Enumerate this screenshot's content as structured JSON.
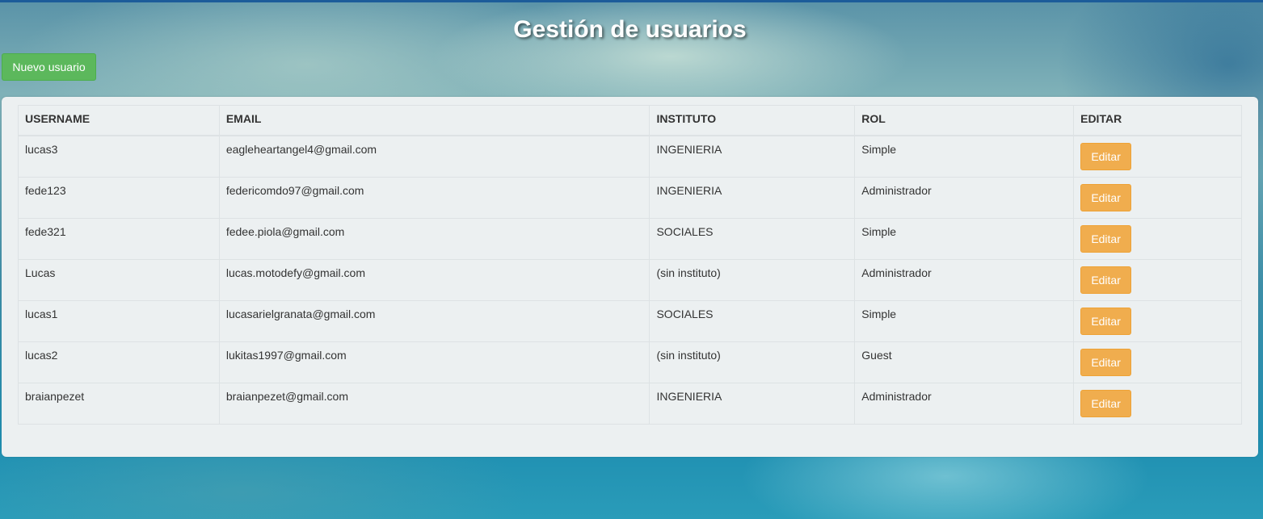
{
  "header": {
    "title": "Gestión de usuarios"
  },
  "toolbar": {
    "new_user_label": "Nuevo usuario"
  },
  "table": {
    "columns": [
      "USERNAME",
      "EMAIL",
      "INSTITUTO",
      "ROL",
      "EDITAR"
    ],
    "rows": [
      {
        "username": "lucas3",
        "email": "eagleheartangel4@gmail.com",
        "instituto": "INGENIERIA",
        "rol": "Simple",
        "edit_label": "Editar"
      },
      {
        "username": "fede123",
        "email": "federicomdo97@gmail.com",
        "instituto": "INGENIERIA",
        "rol": "Administrador",
        "edit_label": "Editar"
      },
      {
        "username": "fede321",
        "email": "fedee.piola@gmail.com",
        "instituto": "SOCIALES",
        "rol": "Simple",
        "edit_label": "Editar"
      },
      {
        "username": "Lucas",
        "email": "lucas.motodefy@gmail.com",
        "instituto": "(sin instituto)",
        "rol": "Administrador",
        "edit_label": "Editar"
      },
      {
        "username": "lucas1",
        "email": "lucasarielgranata@gmail.com",
        "instituto": "SOCIALES",
        "rol": "Simple",
        "edit_label": "Editar"
      },
      {
        "username": "lucas2",
        "email": "lukitas1997@gmail.com",
        "instituto": "(sin instituto)",
        "rol": "Guest",
        "edit_label": "Editar"
      },
      {
        "username": "braianpezet",
        "email": "braianpezet@gmail.com",
        "instituto": "INGENIERIA",
        "rol": "Administrador",
        "edit_label": "Editar"
      }
    ]
  },
  "colors": {
    "success_button": "#5cb85c",
    "warning_button": "#f0ad4e",
    "panel_background": "#ecf0f1"
  }
}
